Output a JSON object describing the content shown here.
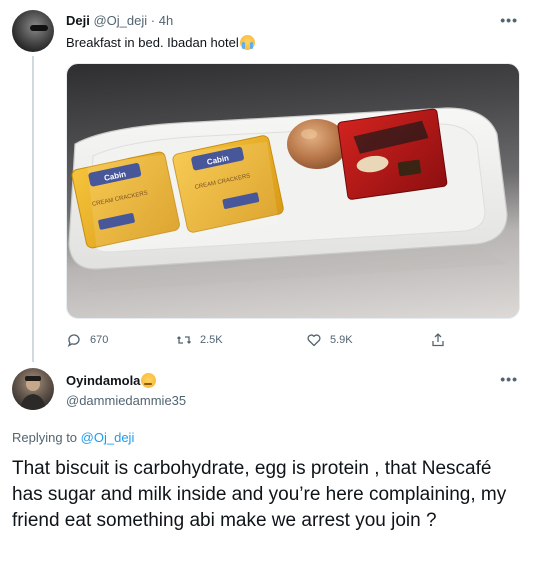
{
  "tweet": {
    "author": "Deji",
    "handle": "@Oj_deji",
    "separator": "·",
    "time": "4h",
    "text": "Breakfast in bed. Ibadan hotel",
    "emoji": "loudly-crying-face",
    "more": "•••",
    "image_alt": "Two packs of cabin cream crackers, a boiled egg and a Nescafé sachet on a white plate",
    "cracker_brand": "Cabin",
    "cracker_label": "CREAM CRACKERS",
    "actions": {
      "replies": "670",
      "retweets": "2.5K",
      "likes": "5.9K"
    }
  },
  "reply": {
    "author": "Oyindamola",
    "emoji": "thinking-face",
    "handle": "@dammiedammie35",
    "more": "•••",
    "replying_prefix": "Replying to",
    "replying_to": "@Oj_deji",
    "text": "That biscuit is carbohydrate, egg is protein , that Nescafé has sugar and milk inside and you’re here complaining, my friend eat something abi make we arrest you join ?"
  },
  "colors": {
    "accent": "#1d9bf0",
    "secondary_text": "#536471",
    "thread_line": "#cfd9de"
  }
}
